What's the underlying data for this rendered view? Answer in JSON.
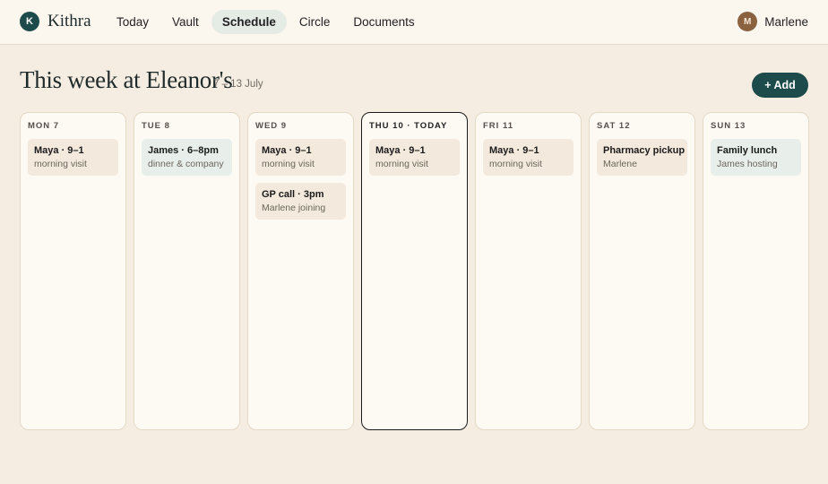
{
  "app": {
    "logo_initial": "K",
    "name": "Kithra"
  },
  "nav": {
    "items": [
      {
        "label": "Today",
        "active": false
      },
      {
        "label": "Vault",
        "active": false
      },
      {
        "label": "Schedule",
        "active": true
      },
      {
        "label": "Circle",
        "active": false
      },
      {
        "label": "Documents",
        "active": false
      }
    ]
  },
  "user": {
    "initial": "M",
    "name": "Marlene"
  },
  "page": {
    "title": "This week at Eleanor's",
    "date_range": "7 – 13 July",
    "add_label": "+ Add"
  },
  "days": [
    {
      "label": "MON 7",
      "today": false,
      "events": [
        {
          "title": "Maya · 9–1",
          "subtitle": "morning visit",
          "tone": "warm"
        }
      ]
    },
    {
      "label": "TUE 8",
      "today": false,
      "events": [
        {
          "title": "James · 6–8pm",
          "subtitle": "dinner & company",
          "tone": "cool"
        }
      ]
    },
    {
      "label": "WED 9",
      "today": false,
      "events": [
        {
          "title": "Maya · 9–1",
          "subtitle": "morning visit",
          "tone": "warm"
        },
        {
          "title": "GP call · 3pm",
          "subtitle": "Marlene joining",
          "tone": "warm"
        }
      ]
    },
    {
      "label": "THU 10 · TODAY",
      "today": true,
      "events": [
        {
          "title": "Maya · 9–1",
          "subtitle": "morning visit",
          "tone": "warm"
        }
      ]
    },
    {
      "label": "FRI 11",
      "today": false,
      "events": [
        {
          "title": "Maya · 9–1",
          "subtitle": "morning visit",
          "tone": "warm"
        }
      ]
    },
    {
      "label": "SAT 12",
      "today": false,
      "events": [
        {
          "title": "Pharmacy pickup",
          "subtitle": "Marlene",
          "tone": "warm"
        }
      ]
    },
    {
      "label": "SUN 13",
      "today": false,
      "events": [
        {
          "title": "Family lunch",
          "subtitle": "James hosting",
          "tone": "cool"
        }
      ]
    }
  ],
  "colors": {
    "brand": "#1d4a4a",
    "background": "#f5ede1",
    "warm_event": "#f3e9dd",
    "cool_event": "#e8eeea"
  }
}
